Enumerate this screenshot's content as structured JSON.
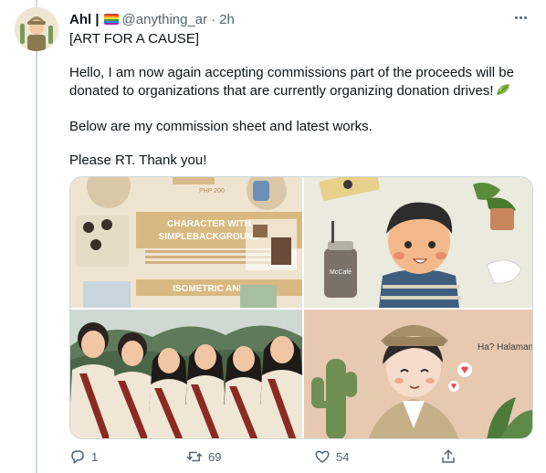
{
  "author": {
    "display_name": "Ahl |",
    "handle": "@anything_ar",
    "dot": "·",
    "time": "2h"
  },
  "tweet": {
    "line1": "[ART FOR A CAUSE]",
    "line2": "Hello, I am now again accepting commissions part of the proceeds will be donated to organizations that are currently organizing donation drives!",
    "line3": "Below are my commission sheet and latest works.",
    "line4": "Please RT. Thank you!"
  },
  "media": {
    "commission_sheet": {
      "price_top": "PHP 200",
      "heading_1": "CHARACTER WITH",
      "heading_2": "SIMPLEBACKGROUND",
      "heading_3": "ISOMETRIC AND"
    },
    "tumbler_text": "McCafé",
    "speech_text": "Ha? Halaman"
  },
  "actions": {
    "reply_count": "1",
    "retweet_count": "69",
    "like_count": "54"
  },
  "icons": [
    "more-icon",
    "rainbow-flag-icon",
    "leaf-icon",
    "reply-icon",
    "retweet-icon",
    "like-icon",
    "share-icon"
  ],
  "colors": {
    "text_primary": "#0f1419",
    "text_secondary": "#536471",
    "border": "#cfd9de",
    "leaf_green": "#7cb342"
  }
}
